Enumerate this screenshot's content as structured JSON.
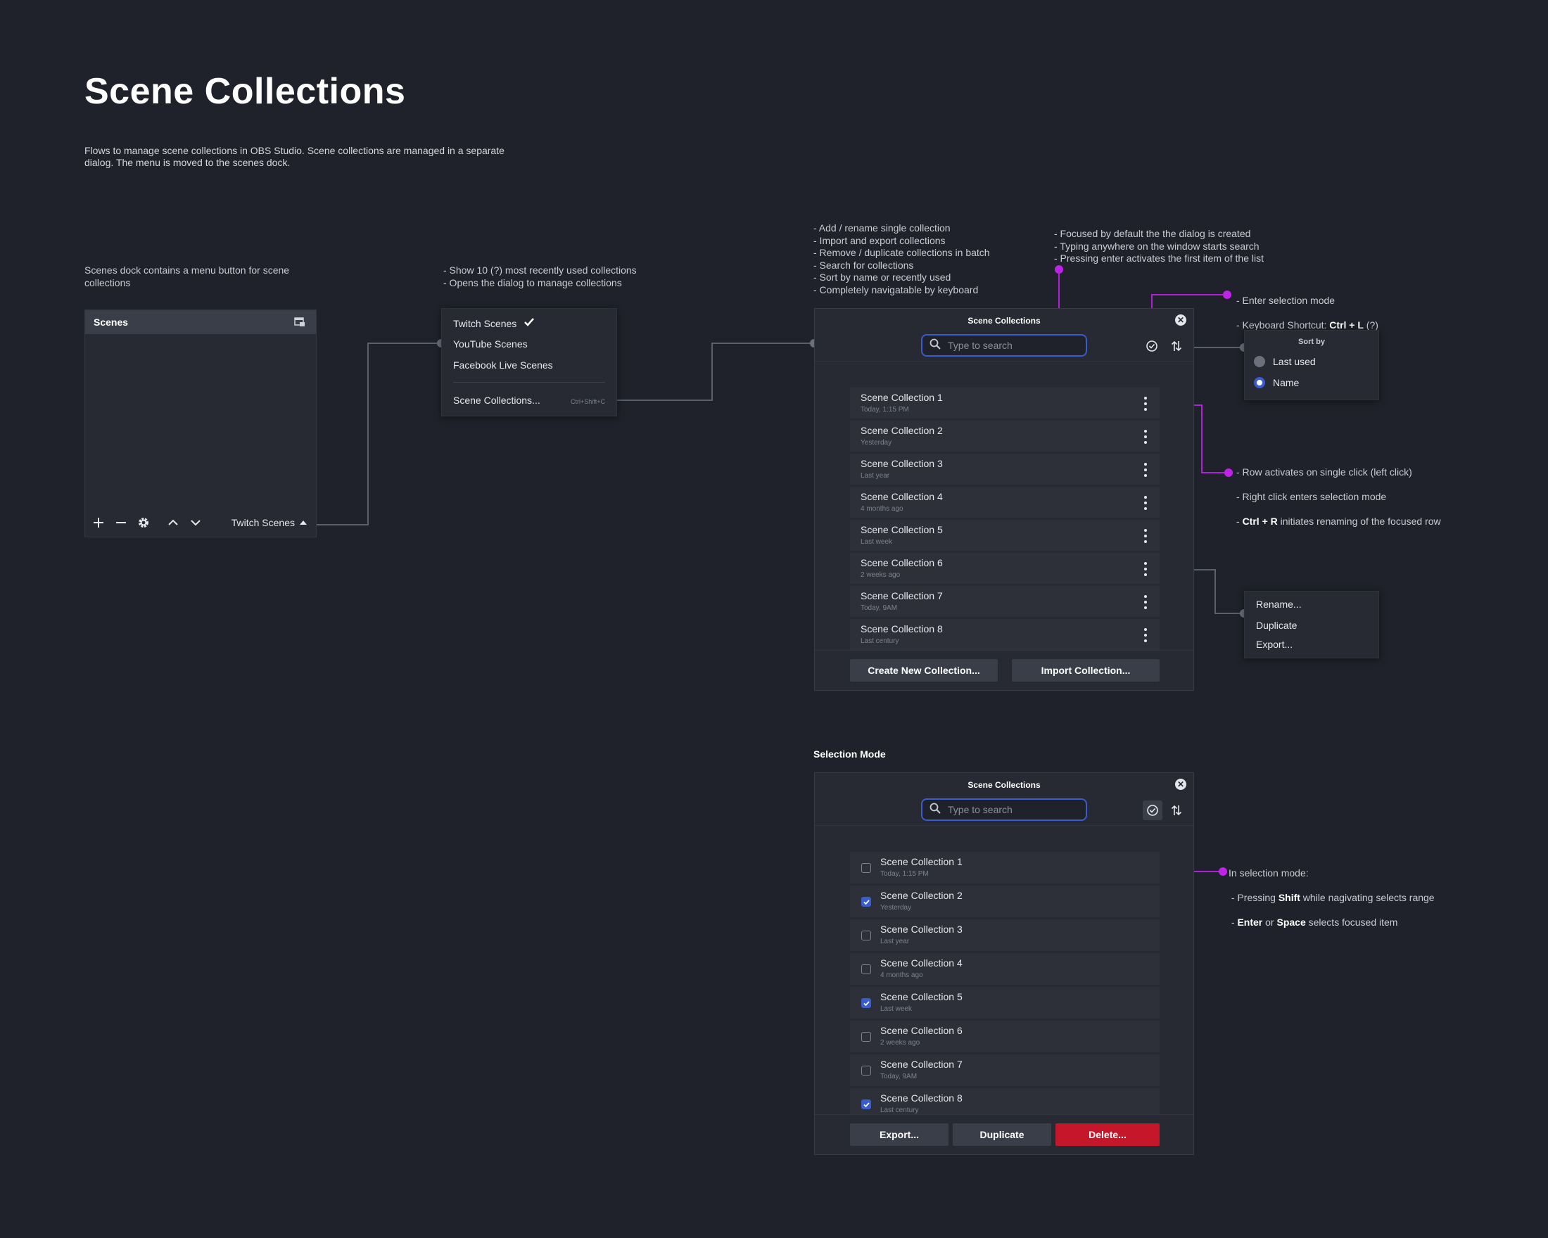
{
  "page": {
    "title": "Scene Collections",
    "description": "Flows to manage scene collections in OBS Studio. Scene collections are managed in a separate dialog. The menu is moved to the scenes dock."
  },
  "notes": {
    "dock_note": "Scenes dock contains a menu button for scene collections",
    "menu_note": "- Show 10 (?) most recently used collections\n- Opens the dialog to manage collections",
    "dialog_note": "- Add / rename  single collection\n- Import and export collections\n- Remove / duplicate collections in batch\n- Search for collections\n- Sort by name or recently used\n- Completely navigatable by keyboard",
    "search_note": "- Focused by default the the dialog is created\n- Typing anywhere on the window starts search\n- Pressing enter activates the first item of the list",
    "selection_note": {
      "line1": "- Enter selection mode",
      "line2_prefix": "- Keyboard Shortcut: ",
      "line2_bold": "Ctrl + L",
      "line2_suffix": " (?)"
    },
    "row_note": {
      "line1": "- Row activates on single click (left click)",
      "line2": "- Right click enters selection mode",
      "line3_bold": "Ctrl + R",
      "line3_suffix": " initiates renaming of the focused row"
    },
    "selmode_note": {
      "line1": "In selection mode:",
      "line2_prefix": "- Pressing ",
      "line2_bold": "Shift",
      "line2_suffix": " while nagivating selects range",
      "line3_bold1": "Enter",
      "line3_mid": " or ",
      "line3_bold2": "Space",
      "line3_suffix": " selects focused item"
    }
  },
  "dock": {
    "title": "Scenes",
    "menu_label": "Twitch Scenes",
    "icons": [
      "plus-icon",
      "minus-icon",
      "gear-icon",
      "chevron-up-icon",
      "chevron-down-icon",
      "caret-up-icon",
      "undock-icon"
    ]
  },
  "menu": {
    "items": [
      {
        "label": "Twitch Scenes",
        "checked": true
      },
      {
        "label": "YouTube Scenes"
      },
      {
        "label": "Facebook Live Scenes"
      }
    ],
    "manage_label": "Scene Collections...",
    "manage_shortcut": "Ctrl+Shift+C"
  },
  "dialog": {
    "title": "Scene Collections",
    "search_placeholder": "Type to search",
    "rows": [
      {
        "name": "Scene Collection 1",
        "sub": "Today, 1:15 PM"
      },
      {
        "name": "Scene Collection 2",
        "sub": "Yesterday"
      },
      {
        "name": "Scene Collection 3",
        "sub": "Last year"
      },
      {
        "name": "Scene Collection 4",
        "sub": "4 months ago"
      },
      {
        "name": "Scene Collection 5",
        "sub": "Last week"
      },
      {
        "name": "Scene Collection 6",
        "sub": "2 weeks ago"
      },
      {
        "name": "Scene Collection 7",
        "sub": "Today, 9AM"
      },
      {
        "name": "Scene Collection 8",
        "sub": "Last century"
      }
    ],
    "create_label": "Create New Collection...",
    "import_label": "Import Collection..."
  },
  "sort_popover": {
    "title": "Sort by",
    "options": [
      {
        "label": "Last used",
        "selected": false
      },
      {
        "label": "Name",
        "selected": true
      }
    ]
  },
  "context_menu": {
    "items": [
      "Rename...",
      "Duplicate",
      "Export..."
    ]
  },
  "selection_mode": {
    "section_label": "Selection Mode",
    "title": "Scene Collections",
    "search_placeholder": "Type to search",
    "rows": [
      {
        "name": "Scene Collection 1",
        "sub": "Today, 1:15 PM",
        "checked": false
      },
      {
        "name": "Scene Collection 2",
        "sub": "Yesterday",
        "checked": true
      },
      {
        "name": "Scene Collection 3",
        "sub": "Last year",
        "checked": false
      },
      {
        "name": "Scene Collection 4",
        "sub": "4 months ago",
        "checked": false
      },
      {
        "name": "Scene Collection 5",
        "sub": "Last week",
        "checked": true
      },
      {
        "name": "Scene Collection 6",
        "sub": "2 weeks ago",
        "checked": false
      },
      {
        "name": "Scene Collection 7",
        "sub": "Today, 9AM",
        "checked": false
      },
      {
        "name": "Scene Collection 8",
        "sub": "Last century",
        "checked": true
      }
    ],
    "export_label": "Export...",
    "duplicate_label": "Duplicate",
    "delete_label": "Delete..."
  },
  "colors": {
    "background": "#1f222a",
    "panel": "#272a33",
    "accent": "#3a5ccc",
    "danger": "#c4182a",
    "annotation": "#c023e8"
  }
}
